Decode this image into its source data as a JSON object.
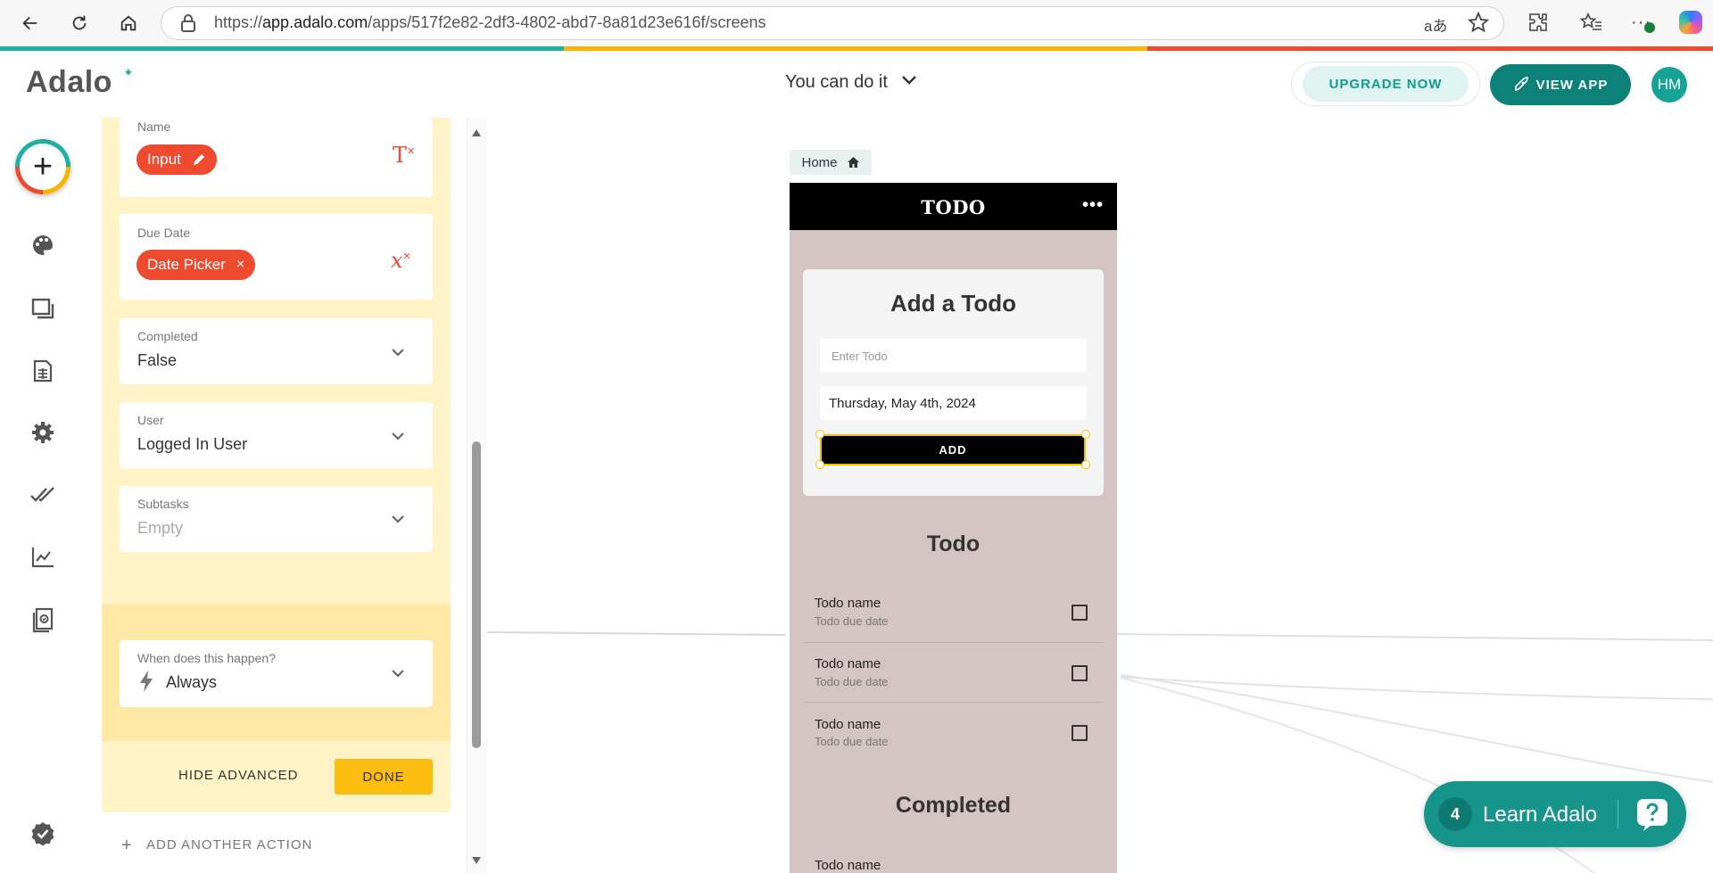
{
  "browser": {
    "url_prefix": "https://",
    "url_domain": "app.adalo.com",
    "url_path": "/apps/517f2e82-2df3-4802-abd7-8a81d23e616f/screens",
    "read_aloud_label": "aあ"
  },
  "header": {
    "logo": "Adalo",
    "project_name": "You can do it",
    "upgrade_label": "UPGRADE NOW",
    "view_app_label": "VIEW APP",
    "avatar_initials": "HM"
  },
  "stripe_colors": [
    "#1fb0a1",
    "#f7b500",
    "#ee4a30"
  ],
  "action_panel": {
    "name_field": {
      "label": "Name",
      "pill": "Input"
    },
    "due_date_field": {
      "label": "Due Date",
      "pill": "Date Picker",
      "clear": "×"
    },
    "completed_field": {
      "label": "Completed",
      "value": "False"
    },
    "user_field": {
      "label": "User",
      "value": "Logged In User"
    },
    "subtasks_field": {
      "label": "Subtasks",
      "value": "Empty"
    },
    "trigger_field": {
      "label": "When does this happen?",
      "value": "Always"
    },
    "hide_advanced": "HIDE ADVANCED",
    "done": "DONE",
    "add_another": "ADD ANOTHER ACTION"
  },
  "phone": {
    "screen_label": "Home",
    "app_title": "TODO",
    "more": "•••",
    "add_title": "Add a Todo",
    "todo_placeholder": "Enter Todo",
    "date_value": "Thursday, May 4th, 2024",
    "add_button": "ADD",
    "todo_heading": "Todo",
    "todos": [
      {
        "name": "Todo name",
        "date": "Todo due date"
      },
      {
        "name": "Todo name",
        "date": "Todo due date"
      },
      {
        "name": "Todo name",
        "date": "Todo due date"
      }
    ],
    "completed_heading": "Completed",
    "completed_first_name": "Todo name"
  },
  "learn": {
    "count": "4",
    "label": "Learn Adalo"
  }
}
